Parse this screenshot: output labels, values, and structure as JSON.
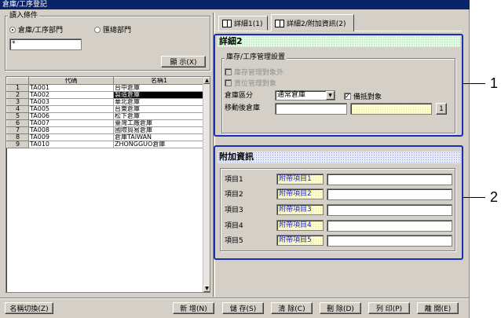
{
  "window": {
    "title": "倉庫/工序登記"
  },
  "filter": {
    "legend": "讀入條件",
    "radio_dept": "倉庫/工序部門",
    "radio_total": "匯總部門",
    "input_value": "*",
    "display_button": "顯 示(X)"
  },
  "grid": {
    "headers": [
      "代碼",
      "名稱1"
    ],
    "rows": [
      {
        "num": "1",
        "code": "TA001",
        "name": "台中倉庫"
      },
      {
        "num": "2",
        "code": "TA002",
        "name": "製造倉庫"
      },
      {
        "num": "3",
        "code": "TA003",
        "name": "華北倉庫"
      },
      {
        "num": "4",
        "code": "TA005",
        "name": "台東倉庫"
      },
      {
        "num": "5",
        "code": "TA006",
        "name": "松下倉庫"
      },
      {
        "num": "6",
        "code": "TA007",
        "name": "臺灣工廠倉庫"
      },
      {
        "num": "7",
        "code": "TA008",
        "name": "國際貿易倉庫"
      },
      {
        "num": "8",
        "code": "TA009",
        "name": "倉庫TAIWAN"
      },
      {
        "num": "9",
        "code": "TA010",
        "name": "ZHONGGUO倉庫"
      }
    ]
  },
  "tabs": [
    {
      "label": "詳細1(1)"
    },
    {
      "label": "詳細2/附加資訊(2)"
    }
  ],
  "detail2": {
    "title": "詳細2",
    "group_legend": "庫存/工序管理設置",
    "chk_exclude": "庫存管理對象外",
    "chk_location": "貨位管理對象",
    "warehouse_type_label": "倉庫區分",
    "warehouse_type_value": "通常倉庫",
    "chk_offset": "備抵對象",
    "move_target_label": "移動後倉庫",
    "ref_button": "1"
  },
  "extra": {
    "title": "附加資訊",
    "items": [
      {
        "label": "項目1",
        "ref": "附帶項目1"
      },
      {
        "label": "項目2",
        "ref": "附帶項目2"
      },
      {
        "label": "項目3",
        "ref": "附帶項目3"
      },
      {
        "label": "項目4",
        "ref": "附帶項目4"
      },
      {
        "label": "項目5",
        "ref": "附帶項目5"
      }
    ]
  },
  "footer": {
    "rename_toggle": "名稱切換(Z)",
    "new": "新 增(N)",
    "save": "儲 存(S)",
    "clear": "清 除(C)",
    "delete": "刪 除(D)",
    "print": "列 印(P)",
    "close": "離 開(E)"
  },
  "callouts": {
    "one": "1",
    "two": "2"
  },
  "colors": {
    "callout_border": "#1a2fb8",
    "title_bar": "#0a246a",
    "selection": "#000000"
  }
}
